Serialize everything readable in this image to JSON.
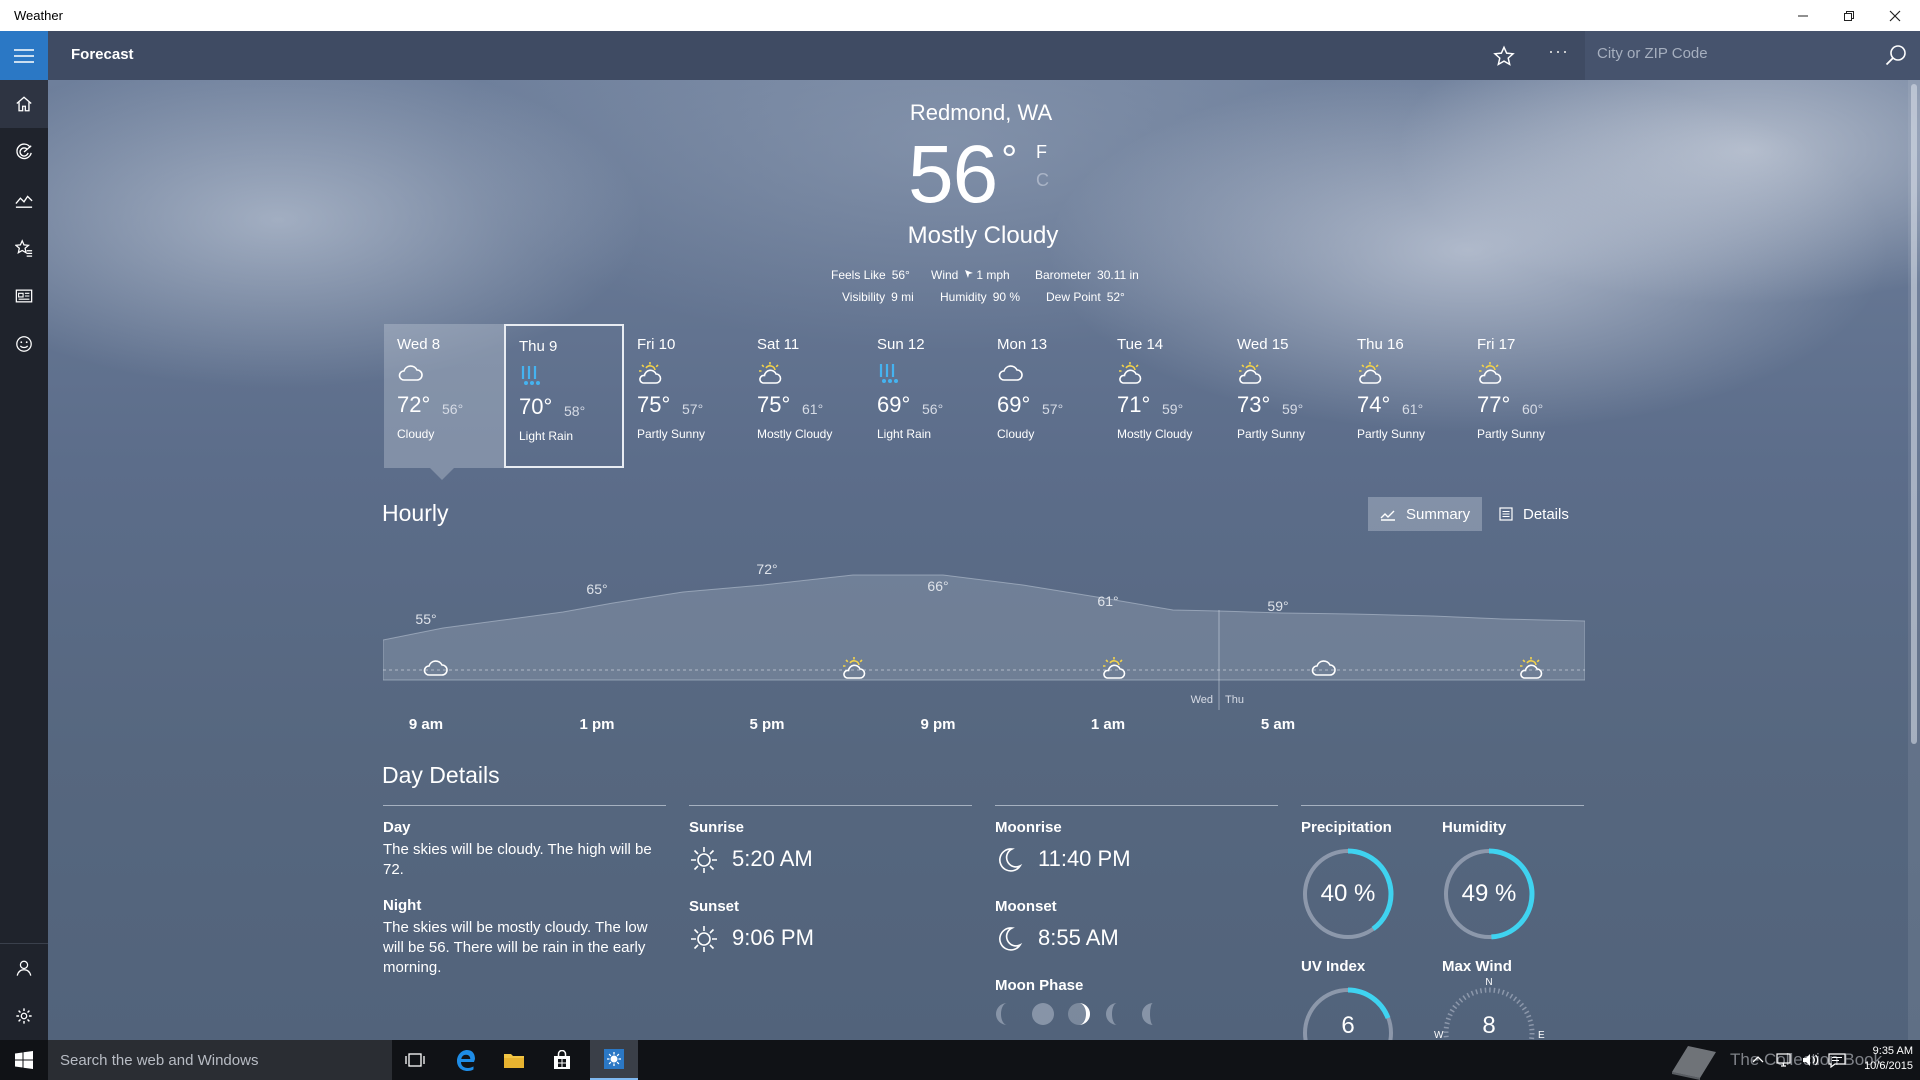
{
  "window": {
    "title": "Weather"
  },
  "header": {
    "section_title": "Forecast",
    "search_placeholder": "City or ZIP Code",
    "more": "···"
  },
  "current": {
    "location": "Redmond, WA",
    "temp": "56",
    "degree": "°",
    "unit_f": "F",
    "unit_c": "C",
    "condition": "Mostly Cloudy",
    "feels_like_label": "Feels Like",
    "feels_like": "56°",
    "wind_label": "Wind",
    "wind": "1 mph",
    "barometer_label": "Barometer",
    "barometer": "30.11 in",
    "visibility_label": "Visibility",
    "visibility": "9 mi",
    "humidity_label": "Humidity",
    "humidity": "90 %",
    "dewpoint_label": "Dew Point",
    "dewpoint": "52°"
  },
  "daily": [
    {
      "day": "Wed 8",
      "hi": "72°",
      "lo": "56°",
      "cond": "Cloudy",
      "icon": "cloud-icon"
    },
    {
      "day": "Thu 9",
      "hi": "70°",
      "lo": "58°",
      "cond": "Light Rain",
      "icon": "rain-icon"
    },
    {
      "day": "Fri 10",
      "hi": "75°",
      "lo": "57°",
      "cond": "Partly Sunny",
      "icon": "partly-sunny-icon"
    },
    {
      "day": "Sat 11",
      "hi": "75°",
      "lo": "61°",
      "cond": "Mostly Cloudy",
      "icon": "partly-sunny-icon"
    },
    {
      "day": "Sun 12",
      "hi": "69°",
      "lo": "56°",
      "cond": "Light Rain",
      "icon": "rain-icon"
    },
    {
      "day": "Mon 13",
      "hi": "69°",
      "lo": "57°",
      "cond": "Cloudy",
      "icon": "cloud-icon"
    },
    {
      "day": "Tue 14",
      "hi": "71°",
      "lo": "59°",
      "cond": "Mostly Cloudy",
      "icon": "partly-sunny-icon"
    },
    {
      "day": "Wed 15",
      "hi": "73°",
      "lo": "59°",
      "cond": "Partly Sunny",
      "icon": "partly-sunny-icon"
    },
    {
      "day": "Thu 16",
      "hi": "74°",
      "lo": "61°",
      "cond": "Partly Sunny",
      "icon": "partly-sunny-icon"
    },
    {
      "day": "Fri 17",
      "hi": "77°",
      "lo": "60°",
      "cond": "Partly Sunny",
      "icon": "partly-sunny-icon"
    }
  ],
  "hourly": {
    "title": "Hourly",
    "summary_label": "Summary",
    "details_label": "Details",
    "temps": [
      "55°",
      "65°",
      "72°",
      "66°",
      "61°",
      "59°"
    ],
    "times": [
      "9 am",
      "1 pm",
      "5 pm",
      "9 pm",
      "1 am",
      "5 am"
    ],
    "day_marker_left": "Wed",
    "day_marker_right": "Thu"
  },
  "details": {
    "title": "Day Details",
    "day_label": "Day",
    "day_text": "The skies will be cloudy. The high will be 72.",
    "night_label": "Night",
    "night_text": "The skies will be mostly cloudy. The low will be 56. There will be rain in the early morning.",
    "sunrise_label": "Sunrise",
    "sunrise": "5:20 AM",
    "sunset_label": "Sunset",
    "sunset": "9:06 PM",
    "moonrise_label": "Moonrise",
    "moonrise": "11:40 PM",
    "moonset_label": "Moonset",
    "moonset": "8:55 AM",
    "moonphase_label": "Moon Phase",
    "precip_label": "Precipitation",
    "precip": "40 %",
    "precip_fraction": 0.4,
    "humidity_label": "Humidity",
    "humidity": "49 %",
    "humidity_fraction": 0.49,
    "uv_label": "UV Index",
    "uv": "6",
    "wind_label": "Max Wind",
    "wind": "8",
    "compass_n": "N",
    "compass_w": "W",
    "compass_e": "E"
  },
  "taskbar": {
    "search_placeholder": "Search the web and Windows",
    "time": "9:35 AM",
    "date": "10/6/2015",
    "watermark": "The Collection Book"
  },
  "colors": {
    "accent": "#2b78c5",
    "ring": "#3fd3f0",
    "rain": "#45b3f0",
    "sun": "#f3d34a"
  }
}
